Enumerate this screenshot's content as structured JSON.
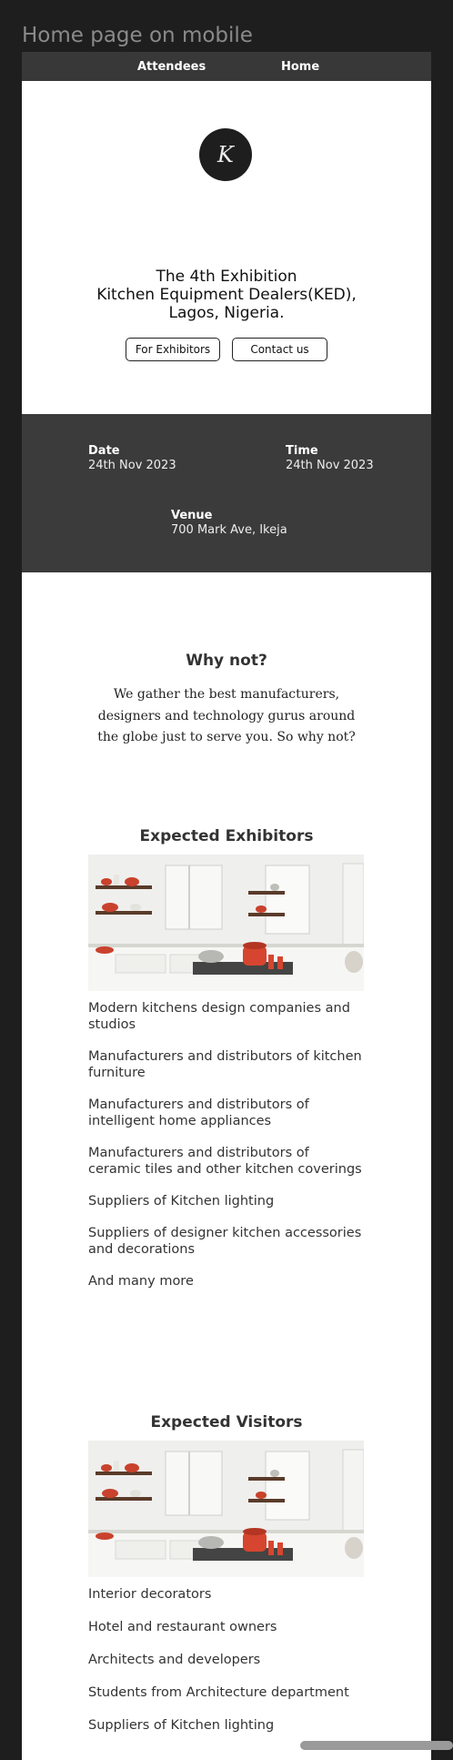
{
  "frame": {
    "label": "Home page on mobile"
  },
  "nav": {
    "attendees": "Attendees",
    "home": "Home"
  },
  "hero": {
    "logo_letter": "K",
    "title_line1": "The 4th Exhibition",
    "title_line2": "Kitchen Equipment Dealers(KED),",
    "title_line3": "Lagos, Nigeria.",
    "btn_exhibitors": "For Exhibitors",
    "btn_contact": "Contact us"
  },
  "info": {
    "date_label": "Date",
    "date_value": "24th Nov 2023",
    "time_label": "Time",
    "time_value": "24th Nov 2023",
    "venue_label": "Venue",
    "venue_value": "700 Mark Ave, Ikeja"
  },
  "why": {
    "title": "Why not?",
    "body": "We gather the best manufacturers, designers and technology gurus around the globe just to serve you. So why not?"
  },
  "exhibitors": {
    "title": "Expected Exhibitors",
    "items": [
      "Modern kitchens design companies and studios",
      "Manufacturers and distributors of kitchen furniture",
      "Manufacturers and distributors of intelligent home appliances",
      "Manufacturers and distributors of ceramic tiles and other kitchen coverings",
      "Suppliers of Kitchen lighting",
      "Suppliers of designer kitchen accessories and decorations",
      "And many more"
    ]
  },
  "visitors": {
    "title": "Expected Visitors",
    "items": [
      "Interior decorators",
      "Hotel and restaurant owners",
      "Architects and developers",
      "Students from Architecture department",
      "Suppliers of Kitchen lighting"
    ]
  },
  "colors": {
    "page_bg": "#1e1e1e",
    "nav_bg": "#383838",
    "info_bg": "#3b3b3b",
    "accent": "#d6452f"
  }
}
